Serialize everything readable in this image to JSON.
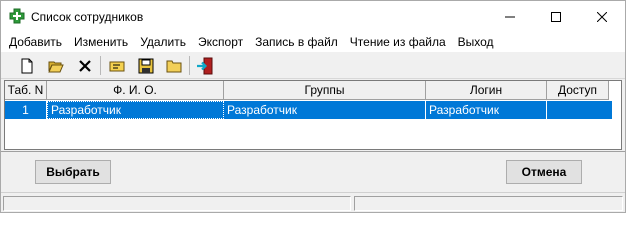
{
  "window": {
    "title": "Список сотрудников",
    "icon": "green-cross-app-icon",
    "controls": [
      "minimize-icon",
      "maximize-icon",
      "close-icon"
    ]
  },
  "menu": {
    "add": "Добавить",
    "edit": "Изменить",
    "delete": "Удалить",
    "export": "Экспорт",
    "write_file": "Запись в файл",
    "read_file": "Чтение из файла",
    "exit": "Выход"
  },
  "toolbar": {
    "icons": [
      "new-document-icon",
      "open-folder-icon",
      "delete-x-icon",
      "edit-icon",
      "save-disk-icon",
      "folder-icon",
      "exit-door-icon"
    ]
  },
  "grid": {
    "headers": {
      "tab": "Таб. N",
      "fio": "Ф. И. О.",
      "groups": "Группы",
      "login": "Логин",
      "access": "Доступ"
    },
    "rows": [
      {
        "tab": "1",
        "fio": "Разработчик",
        "groups": "Разработчик",
        "login": "Разработчик",
        "access": ""
      }
    ]
  },
  "buttons": {
    "select": "Выбрать",
    "cancel": "Отмена"
  },
  "colors": {
    "selection": "#0078d7",
    "toolbar_bg": "#f0f0f0",
    "title_bg": "#ffffff"
  }
}
